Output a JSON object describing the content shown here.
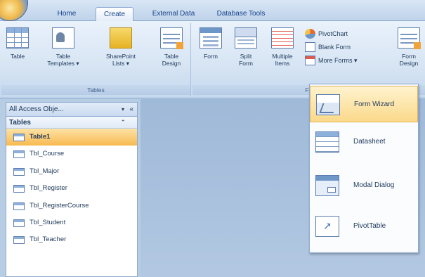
{
  "tabs": [
    {
      "label": "Home"
    },
    {
      "label": "Create"
    },
    {
      "label": "External Data"
    },
    {
      "label": "Database Tools"
    }
  ],
  "ribbon": {
    "tables_group_label": "Tables",
    "forms_group_label": "Fo",
    "buttons": {
      "table": "Table",
      "table_templates": [
        "Table",
        "Templates ▾"
      ],
      "sharepoint_lists": [
        "SharePoint",
        "Lists ▾"
      ],
      "table_design": [
        "Table",
        "Design"
      ],
      "form": "Form",
      "split_form": [
        "Split",
        "Form"
      ],
      "multiple_items": [
        "Multiple",
        "Items"
      ],
      "form_design": [
        "Form",
        "Design"
      ]
    },
    "small_buttons": {
      "pivotchart": "PivotChart",
      "blank_form": "Blank Form",
      "more_forms": "More Forms ▾"
    }
  },
  "nav": {
    "header": "All Access Obje...",
    "dropdown_glyph": "▾",
    "shutter_glyph": "«",
    "group": "Tables",
    "group_collapse_glyph": "⌃",
    "items": [
      {
        "label": "Table1"
      },
      {
        "label": "Tbl_Course"
      },
      {
        "label": "Tbl_Major"
      },
      {
        "label": "Tbl_Register"
      },
      {
        "label": "Tbl_RegisterCourse"
      },
      {
        "label": "Tbl_Student"
      },
      {
        "label": "Tbl_Teacher"
      }
    ]
  },
  "menu": {
    "items": [
      {
        "label": "Form Wizard",
        "icon": "form-wizard-icon"
      },
      {
        "label": "Datasheet",
        "icon": "datasheet-icon"
      },
      {
        "label": "Modal Dialog",
        "icon": "modal-dialog-icon"
      },
      {
        "label": "PivotTable",
        "icon": "pivottable-icon"
      }
    ]
  },
  "colors": {
    "selected_item": "#f8b94f",
    "ribbon": "#d6e4f3",
    "workspace": "#a9c1dd"
  }
}
